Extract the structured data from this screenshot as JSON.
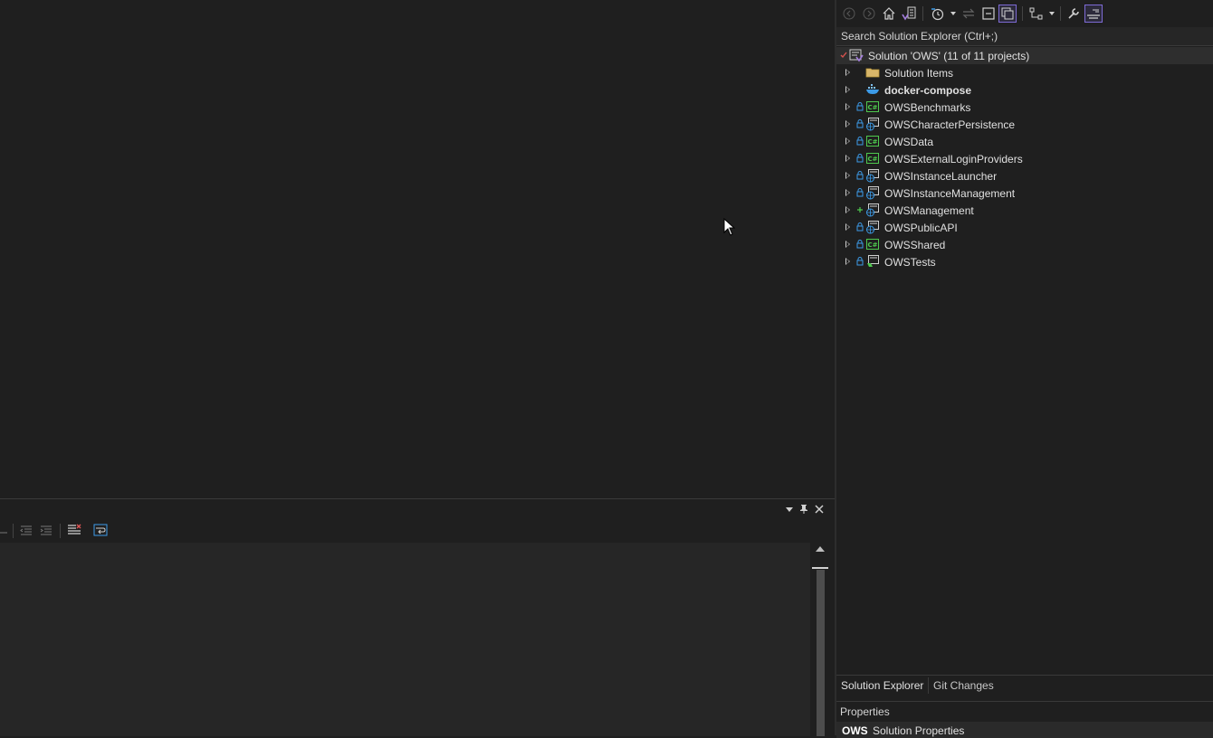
{
  "search": {
    "placeholder": "Search Solution Explorer (Ctrl+;)"
  },
  "solution": {
    "label": "Solution 'OWS' (11 of 11 projects)",
    "items": [
      {
        "label": "Solution Items",
        "icon": "folder-icon",
        "lock": "none",
        "bold": false
      },
      {
        "label": "docker-compose",
        "icon": "docker-compose-icon",
        "lock": "none",
        "bold": true
      },
      {
        "label": "OWSBenchmarks",
        "icon": "csharp-project-icon",
        "lock": "lock",
        "bold": false
      },
      {
        "label": "OWSCharacterPersistence",
        "icon": "web-project-icon",
        "lock": "lock",
        "bold": false
      },
      {
        "label": "OWSData",
        "icon": "csharp-project-icon",
        "lock": "lock",
        "bold": false
      },
      {
        "label": "OWSExternalLoginProviders",
        "icon": "csharp-project-icon",
        "lock": "lock",
        "bold": false
      },
      {
        "label": "OWSInstanceLauncher",
        "icon": "web-project-icon",
        "lock": "lock",
        "bold": false
      },
      {
        "label": "OWSInstanceManagement",
        "icon": "web-project-icon",
        "lock": "lock",
        "bold": false
      },
      {
        "label": "OWSManagement",
        "icon": "web-project-icon",
        "lock": "plus",
        "bold": false
      },
      {
        "label": "OWSPublicAPI",
        "icon": "web-project-icon",
        "lock": "lock",
        "bold": false
      },
      {
        "label": "OWSShared",
        "icon": "csharp-project-icon",
        "lock": "lock",
        "bold": false
      },
      {
        "label": "OWSTests",
        "icon": "test-project-icon",
        "lock": "lock",
        "bold": false
      }
    ]
  },
  "tabs": {
    "solution_explorer": "Solution Explorer",
    "git_changes": "Git Changes"
  },
  "properties": {
    "title": "Properties",
    "object_name": "OWS",
    "object_type": "Solution Properties"
  },
  "colors": {
    "accent": "#7e6bd6",
    "check": "#d9534f",
    "csharp": "#4ec94e",
    "web": "#3c9be8"
  }
}
